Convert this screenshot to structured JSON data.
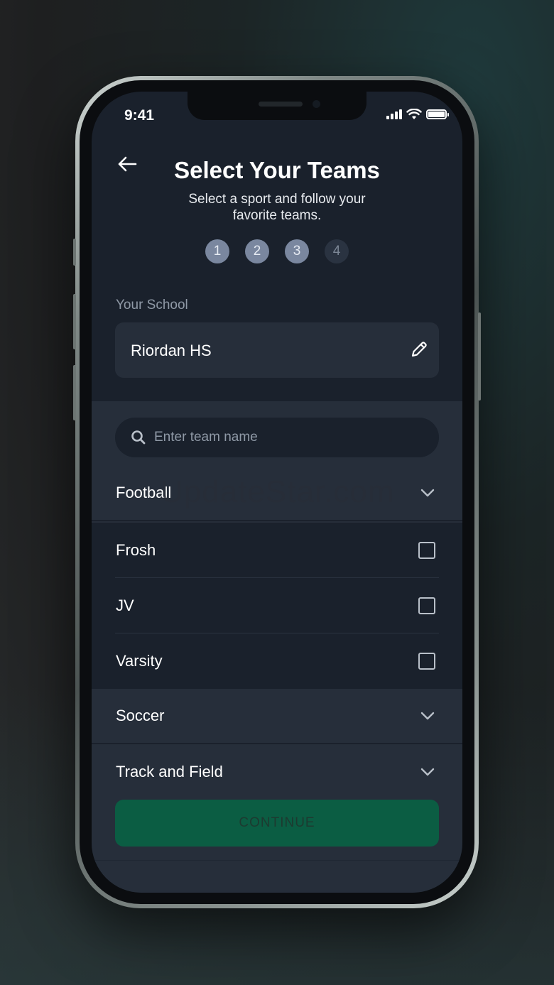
{
  "status_bar": {
    "time": "9:41"
  },
  "header": {
    "title": "Select Your Teams",
    "subtitle": "Select a sport and follow your favorite teams."
  },
  "steps": {
    "labels": [
      "1",
      "2",
      "3",
      "4"
    ],
    "current": 3
  },
  "school": {
    "label": "Your School",
    "value": "Riordan HS"
  },
  "search": {
    "placeholder": "Enter team name",
    "value": ""
  },
  "sports": [
    {
      "name": "Football",
      "expanded": true,
      "levels": [
        {
          "name": "Frosh",
          "checked": false
        },
        {
          "name": "JV",
          "checked": false
        },
        {
          "name": "Varsity",
          "checked": false
        }
      ]
    },
    {
      "name": "Soccer",
      "expanded": false
    },
    {
      "name": "Track and Field",
      "expanded": false
    }
  ],
  "continue_label": "CONTINUE",
  "watermark": "UpdateStar.com",
  "colors": {
    "screen_bg": "#1a212c",
    "panel_bg": "#262e3a",
    "step_active": "#7a879f",
    "step_inactive": "#2a3341",
    "button_bg": "#0b5d43"
  }
}
